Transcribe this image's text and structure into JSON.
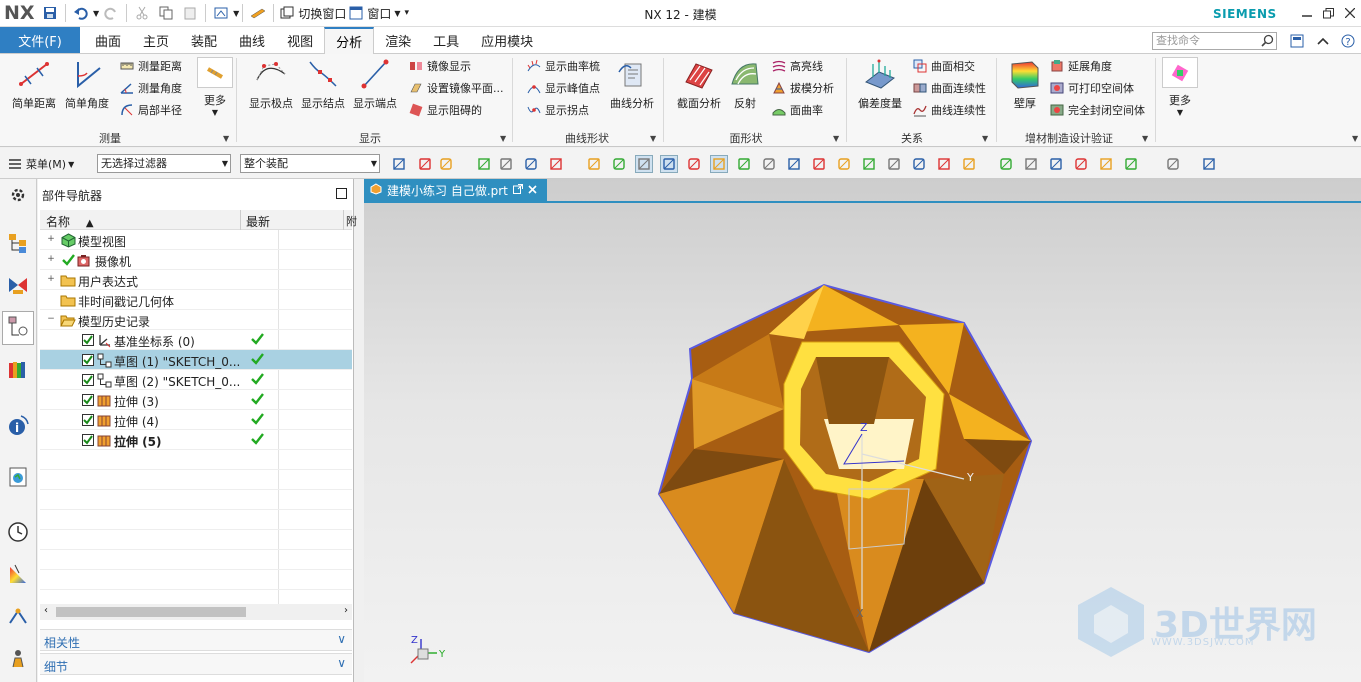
{
  "app": {
    "logo": "NX",
    "title": "NX 12 - 建模",
    "brand": "SIEMENS"
  },
  "quick_access": {
    "switch_window": "切换窗口",
    "window_menu": "窗口"
  },
  "ribbon_tabs": {
    "file": "文件(F)",
    "tabs": [
      "曲面",
      "主页",
      "装配",
      "曲线",
      "视图",
      "分析",
      "渲染",
      "工具",
      "应用模块"
    ],
    "active": "分析"
  },
  "search": {
    "placeholder": "查找命令"
  },
  "ribbon": {
    "measure": {
      "label": "测量",
      "simple_distance": "简单距离",
      "simple_angle": "简单角度",
      "measure_distance": "测量距离",
      "measure_angle": "测量角度",
      "local_radius": "局部半径",
      "more": "更多"
    },
    "display": {
      "label": "显示",
      "show_poles": "显示极点",
      "show_knots": "显示结点",
      "show_endpoints": "显示端点",
      "mirror_display": "镜像显示",
      "set_mirror_plane": "设置镜像平面...",
      "show_obstruction": "显示阻碍的"
    },
    "curve_shape": {
      "label": "曲线形状",
      "show_curvature_comb": "显示曲率梳",
      "show_peaks": "显示峰值点",
      "show_inflections": "显示拐点",
      "curve_analysis": "曲线分析"
    },
    "face_shape": {
      "label": "面形状",
      "section_analysis": "截面分析",
      "reflection": "反射",
      "highlight_lines": "高亮线",
      "draft_analysis": "拔模分析",
      "face_curvature": "面曲率"
    },
    "relation": {
      "label": "关系",
      "deviation_gauge": "偏差度量",
      "face_intersect": "曲面相交",
      "face_continuity": "曲面连续性",
      "curve_continuity": "曲线连续性"
    },
    "additive": {
      "label": "增材制造设计验证",
      "wall_thickness": "壁厚",
      "extend_angle": "延展角度",
      "printable_void": "可打印空间体",
      "fully_enclosed_void": "完全封闭空间体",
      "more": "更多"
    }
  },
  "toolbar": {
    "menu": "菜单(M)",
    "selection_filter": "无选择过滤器",
    "assembly_scope": "整个装配"
  },
  "navigator": {
    "title": "部件导航器",
    "col_name": "名称",
    "col_latest": "最新",
    "col_extra": "附",
    "rows": [
      {
        "label": "模型视图"
      },
      {
        "label": "摄像机"
      },
      {
        "label": "用户表达式"
      },
      {
        "label": "非时间戳记几何体"
      },
      {
        "label": "模型历史记录"
      },
      {
        "label": "基准坐标系 (0)"
      },
      {
        "label": "草图 (1) \"SKETCH_0..."
      },
      {
        "label": "草图 (2) \"SKETCH_0..."
      },
      {
        "label": "拉伸 (3)"
      },
      {
        "label": "拉伸 (4)"
      },
      {
        "label": "拉伸 (5)"
      }
    ],
    "panels": [
      "相关性",
      "细节"
    ]
  },
  "viewport": {
    "doc_tab": "建模小练习 自己做.prt",
    "axes": {
      "x": "X",
      "y": "Y",
      "z": "Z"
    },
    "model_color": "#e8940f"
  },
  "watermark": {
    "text": "3D世界网",
    "url": "WWW.3DSJW.COM"
  }
}
